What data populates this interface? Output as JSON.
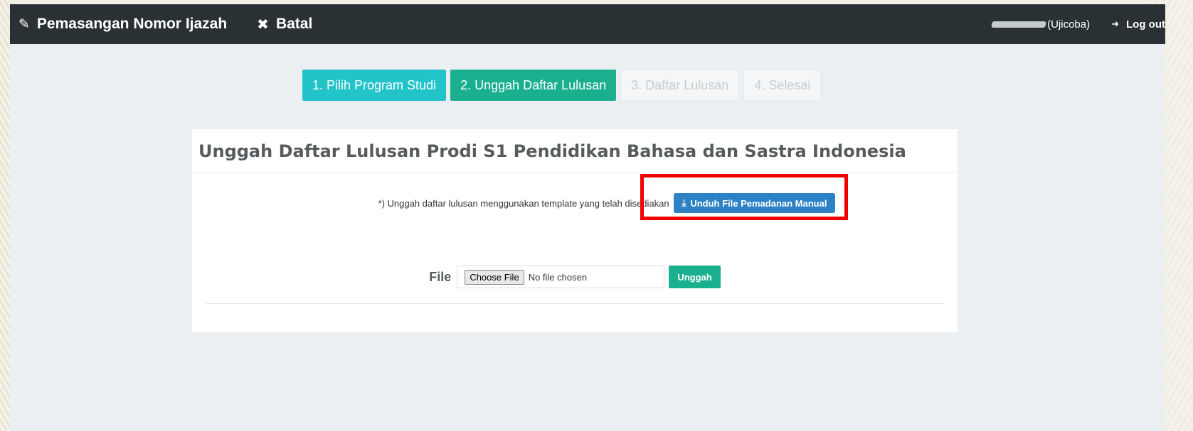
{
  "header": {
    "title": "Pemasangan Nomor Ijazah",
    "title_icon": "pencil-icon",
    "cancel_label": "Batal",
    "cancel_icon": "close-icon",
    "user_label": "(Ujicoba)",
    "logout_label": "Log out",
    "logout_icon": "sign-out-icon"
  },
  "steps": [
    {
      "label": "1. Pilih Program Studi",
      "state": "done"
    },
    {
      "label": "2. Unggah Daftar Lulusan",
      "state": "active"
    },
    {
      "label": "3. Daftar Lulusan",
      "state": "pending"
    },
    {
      "label": "4. Selesai",
      "state": "pending"
    }
  ],
  "panel": {
    "title": "Unggah Daftar Lulusan Prodi S1 Pendidikan Bahasa dan Sastra Indonesia",
    "note": "*) Unggah daftar lulusan menggunakan template yang telah disediakan",
    "download_label": "Unduh File Pemadanan Manual",
    "download_icon": "download-icon",
    "file_label": "File",
    "choose_file_label": "Choose File",
    "file_status": "No file chosen",
    "upload_label": "Unggah"
  },
  "colors": {
    "topbar": "#2a3135",
    "step_done": "#22c3c9",
    "step_active": "#1aaf8f",
    "download": "#2d82c6",
    "highlight": "#f10000"
  }
}
